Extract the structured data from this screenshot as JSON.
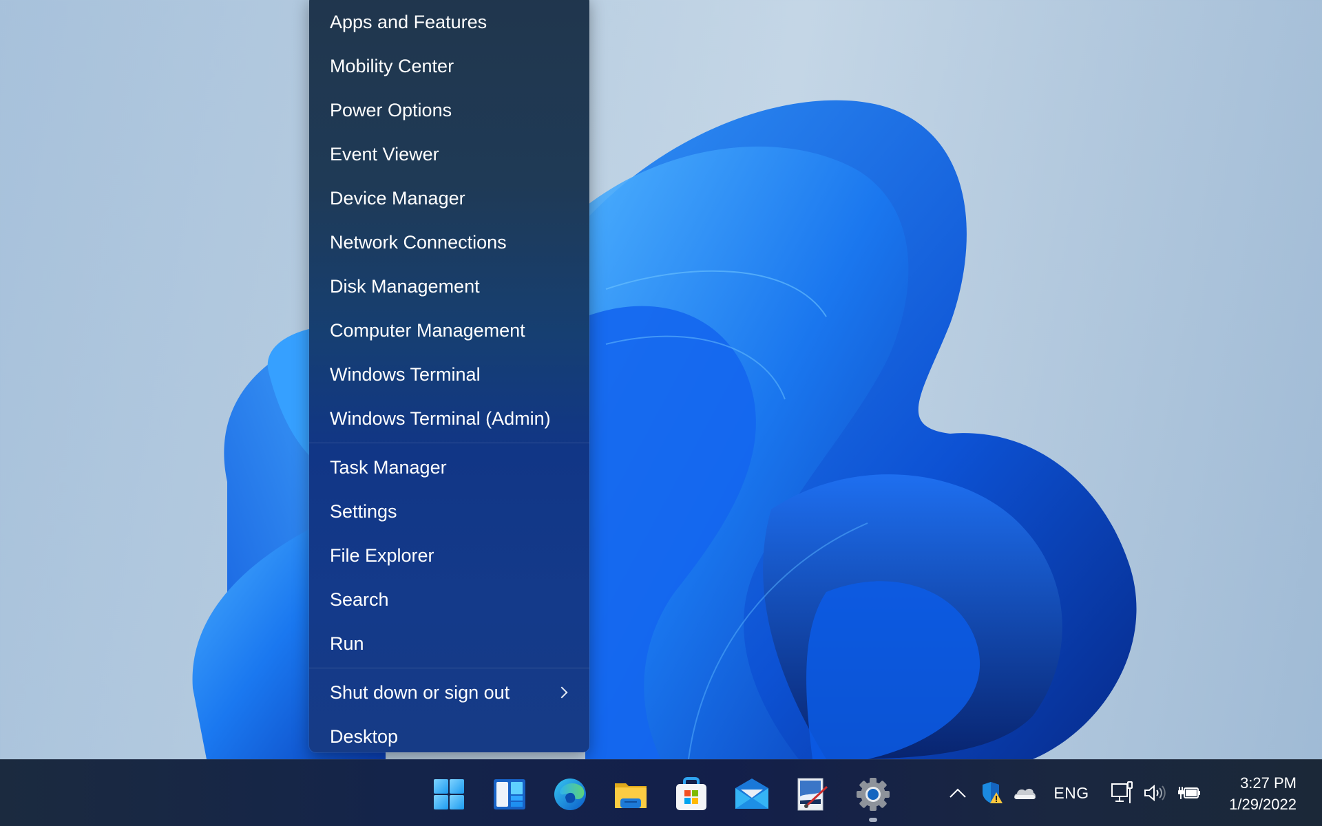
{
  "context_menu": {
    "items": [
      {
        "label": "Apps and Features"
      },
      {
        "label": "Mobility Center"
      },
      {
        "label": "Power Options"
      },
      {
        "label": "Event Viewer"
      },
      {
        "label": "Device Manager"
      },
      {
        "label": "Network Connections"
      },
      {
        "label": "Disk Management"
      },
      {
        "label": "Computer Management"
      },
      {
        "label": "Windows Terminal"
      },
      {
        "label": "Windows Terminal (Admin)"
      },
      {
        "label": "Task Manager"
      },
      {
        "label": "Settings"
      },
      {
        "label": "File Explorer"
      },
      {
        "label": "Search"
      },
      {
        "label": "Run"
      },
      {
        "label": "Shut down or sign out",
        "submenu": true
      },
      {
        "label": "Desktop"
      }
    ]
  },
  "taskbar": {
    "pinned": [
      {
        "name": "Start",
        "icon": "windows-start-icon"
      },
      {
        "name": "Widgets",
        "icon": "widgets-icon"
      },
      {
        "name": "Microsoft Edge",
        "icon": "edge-icon"
      },
      {
        "name": "File Explorer",
        "icon": "folder-icon"
      },
      {
        "name": "Microsoft Store",
        "icon": "store-icon"
      },
      {
        "name": "Mail",
        "icon": "mail-icon"
      },
      {
        "name": "Paint",
        "icon": "paint-icon"
      },
      {
        "name": "Settings",
        "icon": "gear-icon",
        "running": true
      }
    ],
    "tray": {
      "language": "ENG",
      "icons": [
        "chevron-up-icon",
        "security-warning-icon",
        "onedrive-cloud-icon",
        "network-wired-icon",
        "volume-icon",
        "battery-charging-icon"
      ]
    },
    "clock": {
      "time": "3:27 PM",
      "date": "1/29/2022"
    }
  },
  "colors": {
    "menu_top": "#20364d",
    "menu_bottom": "#163b86",
    "taskbar": "#14244a",
    "accent": "#0f6cbd"
  }
}
